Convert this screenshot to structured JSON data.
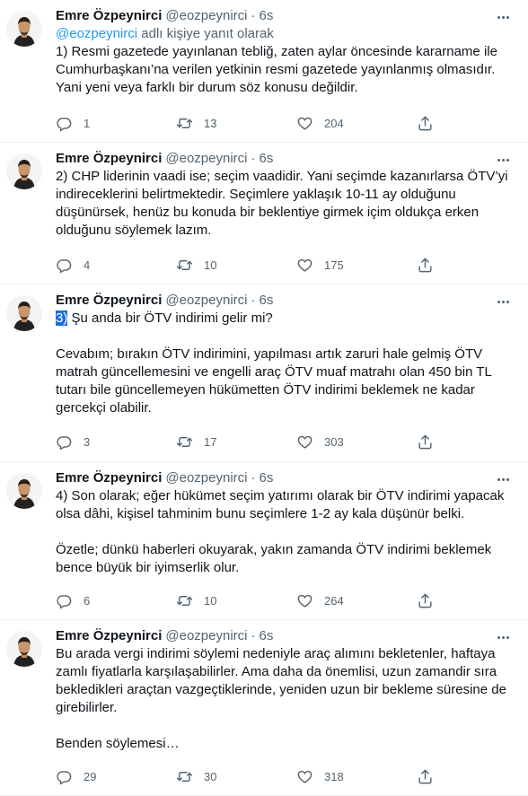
{
  "colors": {
    "accent": "#1d9bf0",
    "muted": "#536471",
    "text": "#0f1419",
    "divider": "#eff3f4",
    "selection": "#1d6fd6"
  },
  "icons": {
    "reply": "reply-icon",
    "retweet": "retweet-icon",
    "like": "heart-icon",
    "share": "share-icon",
    "more": "more-icon"
  },
  "tweets": [
    {
      "name": "Emre Özpeynirci",
      "handle": "@eozpeynirci",
      "separator": "·",
      "time": "6s",
      "reply_prefix": "",
      "reply_mention": "@eozpeynirci",
      "reply_suffix": " adlı kişiye yanıt olarak",
      "lines": [
        "1) Resmi gazetede yayınlanan tebliğ, zaten aylar öncesinde kararname ile Cumhurbaşkanı’na verilen yetkinin resmi gazetede yayınlanmış olmasıdır. Yani yeni veya farklı bir durum söz konusu değildir."
      ],
      "replies": "1",
      "retweets": "13",
      "likes": "204"
    },
    {
      "name": "Emre Özpeynirci",
      "handle": "@eozpeynirci",
      "separator": "·",
      "time": "6s",
      "lines": [
        "2) CHP liderinin vaadi ise; seçim vaadidir. Yani seçimde kazanırlarsa ÖTV’yi indireceklerini belirtmektedir. Seçimlere yaklaşık 10-11 ay olduğunu düşünürsek, henüz bu konuda bir beklentiye girmek içim oldukça erken olduğunu söylemek lazım."
      ],
      "replies": "4",
      "retweets": "10",
      "likes": "175"
    },
    {
      "name": "Emre Özpeynirci",
      "handle": "@eozpeynirci",
      "separator": "·",
      "time": "6s",
      "highlight": "3)",
      "first_rest": " Şu anda bir ÖTV indirimi gelir mi?",
      "lines": [
        "Cevabım; bırakın ÖTV indirimini, yapılması artık zaruri hale gelmiş ÖTV matrah güncellemesini ve engelli araç ÖTV muaf matrahı olan 450 bin TL tutarı bile güncellemeyen hükümetten ÖTV indirimi beklemek ne kadar gercekçi olabilir."
      ],
      "replies": "3",
      "retweets": "17",
      "likes": "303"
    },
    {
      "name": "Emre Özpeynirci",
      "handle": "@eozpeynirci",
      "separator": "·",
      "time": "6s",
      "lines": [
        "4) Son olarak; eğer hükümet seçim yatırımı olarak bir ÖTV indirimi yapacak olsa dâhi, kişisel tahminim bunu seçimlere 1-2 ay kala düşünür belki.",
        "Özetle; dünkü haberleri okuyarak, yakın zamanda ÖTV indirimi beklemek bence büyük bir iyimserlik olur."
      ],
      "replies": "6",
      "retweets": "10",
      "likes": "264"
    },
    {
      "name": "Emre Özpeynirci",
      "handle": "@eozpeynirci",
      "separator": "·",
      "time": "6s",
      "lines": [
        "Bu arada vergi indirimi söylemi nedeniyle araç alımını bekletenler, haftaya zamlı fiyatlarla karşılaşabilirler. Ama daha da önemlisi, uzun zamandir sıra bekledikleri araçtan vazgeçtiklerinde, yeniden uzun bir bekleme süresine de girebilirler.",
        "Benden söylemesi…"
      ],
      "replies": "29",
      "retweets": "30",
      "likes": "318"
    }
  ]
}
